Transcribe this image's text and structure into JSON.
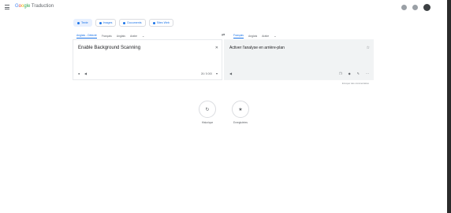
{
  "app": {
    "title_part1": "G",
    "title_part2": "o",
    "title_part3": "o",
    "title_part4": "gle",
    "title_part5": " Traduction"
  },
  "modes": [
    {
      "label": "Texte",
      "active": true
    },
    {
      "label": "Images",
      "active": false
    },
    {
      "label": "Documents",
      "active": false
    },
    {
      "label": "Sites Web",
      "active": false
    }
  ],
  "source_langs": [
    "Anglais - Détecté",
    "Français",
    "Anglais",
    "Arabe"
  ],
  "target_langs": [
    "Français",
    "Anglais",
    "Arabe"
  ],
  "source": {
    "text": "Enable Background Scanning",
    "char_count": "26 / 5 000"
  },
  "target": {
    "text": "Activer l'analyse en arrière-plan"
  },
  "feedback": "Envoyer des commentaires",
  "shortcuts": [
    {
      "label": "Historique"
    },
    {
      "label": "Enregistrées"
    }
  ],
  "colors": {
    "accent": "#1a73e8",
    "panel_target": "#f1f3f4"
  }
}
